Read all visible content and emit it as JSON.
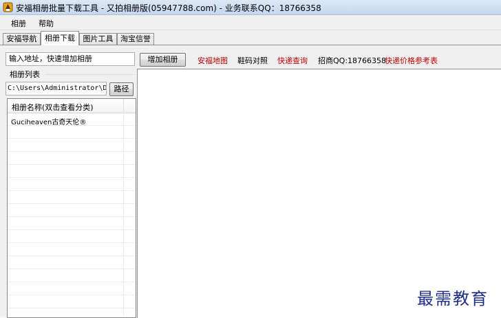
{
  "window": {
    "title": "安福相册批量下载工具 - 又拍相册版(05947788.com) - 业务联系QQ：18766358",
    "icon": "app-logo-icon"
  },
  "menu": {
    "items": [
      {
        "label": "相册"
      },
      {
        "label": "帮助"
      }
    ]
  },
  "tabs": [
    {
      "label": "安福导航",
      "active": false
    },
    {
      "label": "相册下载",
      "active": true
    },
    {
      "label": "图片工具",
      "active": false
    },
    {
      "label": "淘宝信誉",
      "active": false
    }
  ],
  "toolbar": {
    "url_value": "输入地址，快速增加相册",
    "add_button": "增加相册",
    "links": [
      {
        "label": "安福地图",
        "color": "#c00000"
      },
      {
        "label": "鞋码对照",
        "color": "#000000"
      },
      {
        "label": "快递查询",
        "color": "#c00000"
      },
      {
        "label": "招商QQ:18766358",
        "color": "#000000"
      },
      {
        "label": "快递价格参考表",
        "color": "#c00000"
      }
    ]
  },
  "album_list": {
    "group_label": "相册列表",
    "path_value": "C:\\Users\\Administrator\\De",
    "path_button": "路径",
    "column_header": "相册名称(双击查看分类)",
    "rows": [
      {
        "name": "Guciheaven古奇天伦®"
      }
    ]
  },
  "watermark": "最需教育"
}
